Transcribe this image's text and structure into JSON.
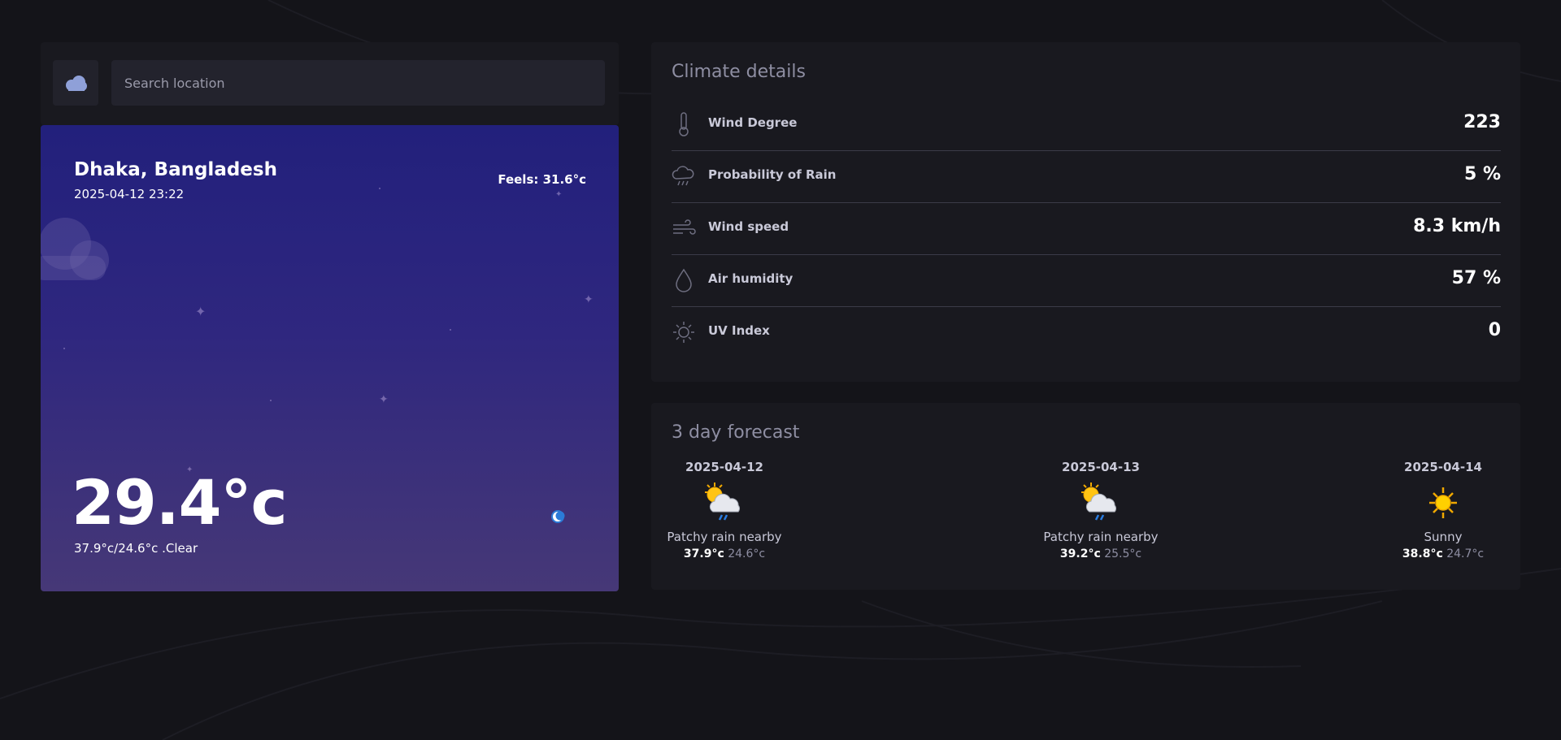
{
  "search": {
    "placeholder": "Search location",
    "logo_icon": "cloud-icon"
  },
  "current": {
    "location": "Dhaka, Bangladesh",
    "datetime": "2025-04-12 23:22",
    "feels": "Feels: 31.6°c",
    "temperature": "29.4°c",
    "minmax": "37.9°c/24.6°c .Clear",
    "night_icon": "moon-icon"
  },
  "climate": {
    "title": "Climate details",
    "rows": [
      {
        "label": "Wind Degree",
        "value": "223",
        "icon": "thermometer-icon"
      },
      {
        "label": "Probability of Rain",
        "value": "5 %",
        "icon": "rain-cloud-icon"
      },
      {
        "label": "Wind speed",
        "value": "8.3 km/h",
        "icon": "wind-icon"
      },
      {
        "label": "Air humidity",
        "value": "57 %",
        "icon": "droplet-icon"
      },
      {
        "label": "UV Index",
        "value": "0",
        "icon": "sun-icon"
      }
    ]
  },
  "forecast": {
    "title": "3 day forecast",
    "days": [
      {
        "date": "2025-04-12",
        "condition": "Patchy rain nearby",
        "high": "37.9°c",
        "low": "24.6°c",
        "icon": "patchy-rain-icon"
      },
      {
        "date": "2025-04-13",
        "condition": "Patchy rain nearby",
        "high": "39.2°c",
        "low": "25.5°c",
        "icon": "patchy-rain-icon"
      },
      {
        "date": "2025-04-14",
        "condition": "Sunny",
        "high": "38.8°c",
        "low": "24.7°c",
        "icon": "sunny-icon"
      }
    ]
  },
  "colors": {
    "background": "#141419",
    "panel": "#19191f",
    "card_gradient_top": "#22207c",
    "card_gradient_bottom": "#463877",
    "muted_text": "#8e8ea2"
  }
}
